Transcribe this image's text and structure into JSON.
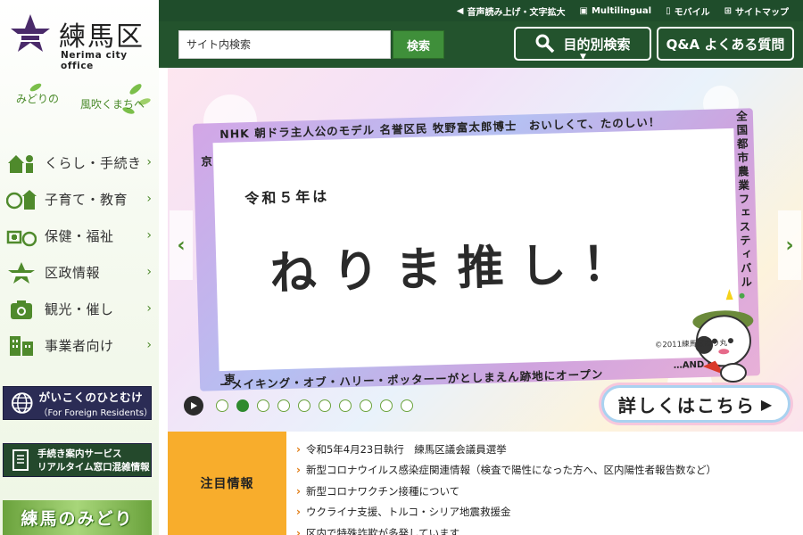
{
  "logo": {
    "name": "練馬区",
    "sub": "Nerima city office",
    "color": "#4a2a6a"
  },
  "tagline": {
    "part1": "みどりの",
    "part2": "風吹くまちへ"
  },
  "nav": [
    {
      "label": "くらし・手続き",
      "icon": "house-person-icon"
    },
    {
      "label": "子育て・教育",
      "icon": "family-school-icon"
    },
    {
      "label": "保健・福祉",
      "icon": "health-welfare-icon"
    },
    {
      "label": "区政情報",
      "icon": "nerima-emblem-icon"
    },
    {
      "label": "観光・催し",
      "icon": "camera-icon"
    },
    {
      "label": "事業者向け",
      "icon": "building-icon"
    }
  ],
  "foreign": {
    "line1": "がいこくのひとむけ",
    "line2": "（For Foreign Residents）"
  },
  "procedure": {
    "line1": "手続き案内サービス",
    "line2": "リアルタイム窓口混雑情報"
  },
  "midori": "練馬のみどり",
  "utility": {
    "voice": "音声読み上げ・文字拡大",
    "multilingual": "Multilingual",
    "mobile": "モバイル",
    "sitemap": "サイトマップ"
  },
  "search": {
    "placeholder": "サイト内検索",
    "button": "検索"
  },
  "header_buttons": {
    "purpose": "目的別検索",
    "faq": "Q&A よくある質問"
  },
  "hero": {
    "frame_top": "NHK 朝ドラ主人公のモデル 名誉区民 牧野富太郎博士　おいしくて、たのしい！",
    "frame_left": "ワーナー ブラザース スタジオツアー東京",
    "frame_right": "全国都市農業フェスティバル",
    "frame_bottom": "ーメイキング・オブ・ハリー・ポッターーがとしまえん跡地にオープン",
    "frame_more": "…AND MORE",
    "sub": "令和５年は",
    "main": "ねりま推し！",
    "copyright": "©2011練馬区ねり丸",
    "more_button": "詳しくはこちら",
    "slide_count": 10,
    "active_slide": 2
  },
  "notices": {
    "heading": "注目情報",
    "items": [
      "令和5年4月23日執行　練馬区議会議員選挙",
      "新型コロナウイルス感染症関連情報（検査で陽性になった方へ、区内陽性者報告数など）",
      "新型コロナワクチン接種について",
      "ウクライナ支援、トルコ・シリア地震救援金",
      "区内で特殊詐欺が多発しています"
    ]
  },
  "colors": {
    "header_green": "#23532d",
    "accent_green": "#3f8f3a",
    "notice_orange": "#f8ad2c",
    "foreign_navy": "#2b2c55"
  }
}
